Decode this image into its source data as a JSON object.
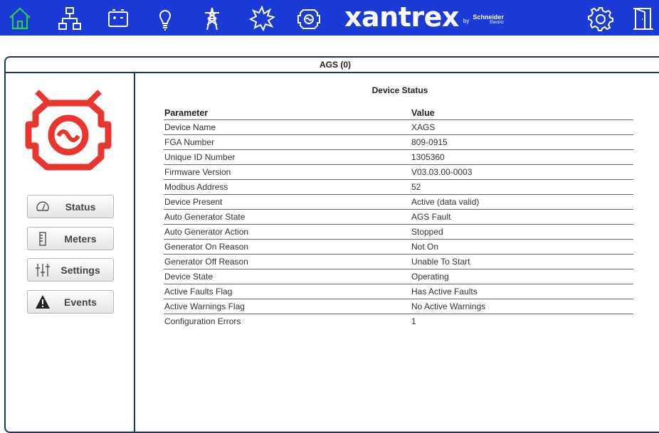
{
  "topbar": {
    "nav_icons": [
      "home-icon",
      "network-icon",
      "battery-icon",
      "bulb-icon",
      "tower-icon",
      "sun-icon",
      "generator-icon"
    ],
    "right_icons": [
      "settings-gear-icon",
      "logout-door-icon"
    ],
    "brand": {
      "name": "xantrex",
      "by": "by",
      "company_line1": "Schneider",
      "company_line2": "Electric"
    },
    "colors": {
      "bar": "#1b3bd6",
      "icon": "#2ecc40",
      "border": "#1d3466",
      "device": "#e8352e"
    }
  },
  "panel": {
    "title": "AGS (0)"
  },
  "sidebar": {
    "device_icon": "generator-device-icon",
    "buttons": [
      {
        "label": "Status",
        "icon": "gauge-icon"
      },
      {
        "label": "Meters",
        "icon": "meter-icon"
      },
      {
        "label": "Settings",
        "icon": "sliders-icon"
      },
      {
        "label": "Events",
        "icon": "warning-icon"
      }
    ]
  },
  "content": {
    "title": "Device Status",
    "columns": [
      "Parameter",
      "Value"
    ],
    "rows": [
      [
        "Device Name",
        "XAGS"
      ],
      [
        "FGA Number",
        "809-0915"
      ],
      [
        "Unique ID Number",
        "1305360"
      ],
      [
        "Firmware Version",
        "V03.03.00-0003"
      ],
      [
        "Modbus Address",
        "52"
      ],
      [
        "Device Present",
        "Active (data valid)"
      ],
      [
        "Auto Generator State",
        "AGS Fault"
      ],
      [
        "Auto Generator Action",
        "Stopped"
      ],
      [
        "Generator On Reason",
        "Not On"
      ],
      [
        "Generator Off Reason",
        "Unable To Start"
      ],
      [
        "Device State",
        "Operating"
      ],
      [
        "Active Faults Flag",
        "Has Active Faults"
      ],
      [
        "Active Warnings Flag",
        "No Active Warnings"
      ],
      [
        "Configuration Errors",
        "1"
      ]
    ]
  }
}
